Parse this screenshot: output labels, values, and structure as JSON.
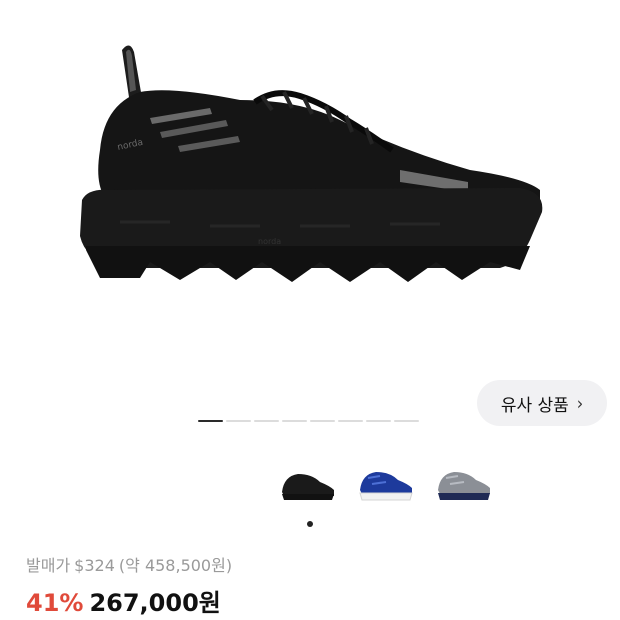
{
  "product": {
    "images_count": 8,
    "active_image_index": 0
  },
  "similar_button": {
    "label": "유사 상품",
    "chevron": "›"
  },
  "thumbnails": [
    {
      "name": "black-colorway",
      "colors": [
        "#1a1a1a",
        "#2a2a2a"
      ]
    },
    {
      "name": "blue-colorway",
      "colors": [
        "#1d3a9c",
        "#f2f2f2"
      ]
    },
    {
      "name": "grey-navy-colorway",
      "colors": [
        "#8b8f96",
        "#1f2a55"
      ]
    }
  ],
  "pricing": {
    "msrp_label": "발매가",
    "msrp_usd": "$324",
    "msrp_krw": "(약 458,500원)",
    "discount": "41%",
    "price": "267,000원"
  }
}
